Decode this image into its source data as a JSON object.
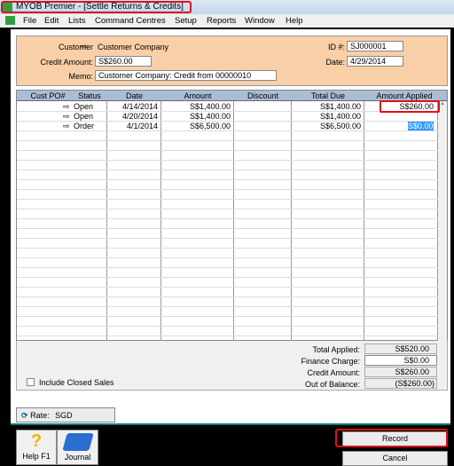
{
  "window": {
    "title": "MYOB Premier - [Settle Returns & Credits]"
  },
  "menu": [
    "File",
    "Edit",
    "Lists",
    "Command Centres",
    "Setup",
    "Reports",
    "Window",
    "Help"
  ],
  "header": {
    "customer_label": "Customer",
    "customer_value": "Customer Company",
    "credit_label": "Credit Amount:",
    "credit_value": "S$260.00",
    "memo_label": "Memo:",
    "memo_value": "Customer Company:  Credit from 00000010",
    "id_label": "ID #:",
    "id_value": "SJ000001",
    "date_label": "Date:",
    "date_value": "4/29/2014"
  },
  "table": {
    "columns": [
      "Cust PO#",
      "Status",
      "Date",
      "Amount",
      "Discount",
      "Total Due",
      "Amount Applied"
    ],
    "rows": [
      {
        "po": "",
        "status": "Open",
        "date": "4/14/2014",
        "amount": "S$1,400.00",
        "discount": "",
        "total_due": "S$1,400.00",
        "applied": "S$260.00"
      },
      {
        "po": "",
        "status": "Open",
        "date": "4/20/2014",
        "amount": "S$1,400.00",
        "discount": "",
        "total_due": "S$1,400.00",
        "applied": ""
      },
      {
        "po": "",
        "status": "Order",
        "date": "4/1/2014",
        "amount": "S$6,500.00",
        "discount": "",
        "total_due": "S$6,500.00",
        "applied": "S$0.00"
      }
    ]
  },
  "summary": {
    "total_applied_label": "Total Applied:",
    "total_applied": "S$520.00",
    "finance_label": "Finance Charge:",
    "finance": "S$0.00",
    "credit_label": "Credit Amount:",
    "credit": "S$260.00",
    "oob_label": "Out of Balance:",
    "oob": "(S$260.00)",
    "include_closed": "Include Closed Sales"
  },
  "rate": {
    "label": "Rate:",
    "value": "SGD"
  },
  "buttons": {
    "help": "Help F1",
    "journal": "Journal",
    "record": "Record",
    "cancel": "Cancel"
  },
  "colors": {
    "header_bg": "#f8cfa6",
    "table_header": "#a9bdd4",
    "highlight": "#e0101a",
    "selection": "#3399ff"
  }
}
